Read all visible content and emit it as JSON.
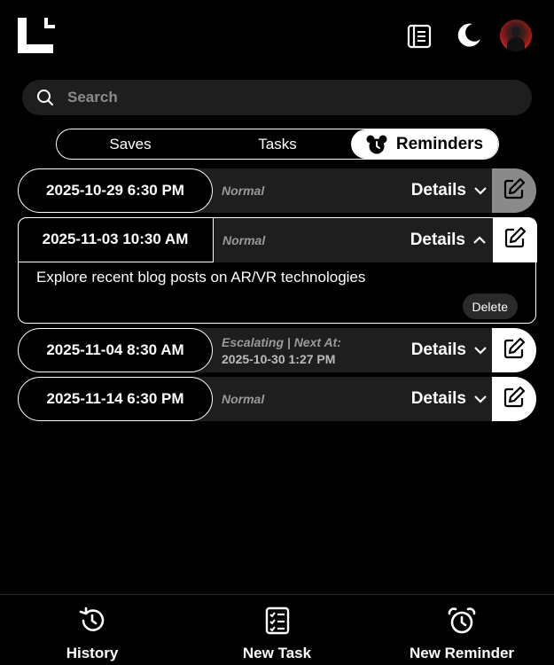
{
  "header": {
    "logo_icon": "corner-l-logo",
    "notebook_icon": "notebook-icon",
    "theme_icon": "moon-icon",
    "avatar_icon": "user-avatar"
  },
  "search": {
    "placeholder": "Search"
  },
  "tabs": [
    {
      "label": "Saves",
      "active": false
    },
    {
      "label": "Tasks",
      "active": false
    },
    {
      "label": "Reminders",
      "active": true
    }
  ],
  "reminders": [
    {
      "date": "2025-10-29 6:30 PM",
      "status": "Normal",
      "status_sub": "",
      "details_label": "Details",
      "expanded": false
    },
    {
      "date": "2025-11-03 10:30 AM",
      "status": "Normal",
      "status_sub": "",
      "details_label": "Details",
      "expanded": true,
      "note": "Explore recent blog posts on AR/VR technologies",
      "delete_label": "Delete"
    },
    {
      "date": "2025-11-04 8:30 AM",
      "status": "Escalating | Next At:",
      "status_sub": "2025-10-30 1:27 PM",
      "details_label": "Details",
      "expanded": false
    },
    {
      "date": "2025-11-14 6:30 PM",
      "status": "Normal",
      "status_sub": "",
      "details_label": "Details",
      "expanded": false
    }
  ],
  "footer": {
    "history": "History",
    "new_task": "New Task",
    "new_reminder": "New Reminder"
  },
  "colors": {
    "background": "#000000",
    "row": "#1e1e1e",
    "accent": "#ffffff",
    "muted": "#9a9a9a"
  }
}
